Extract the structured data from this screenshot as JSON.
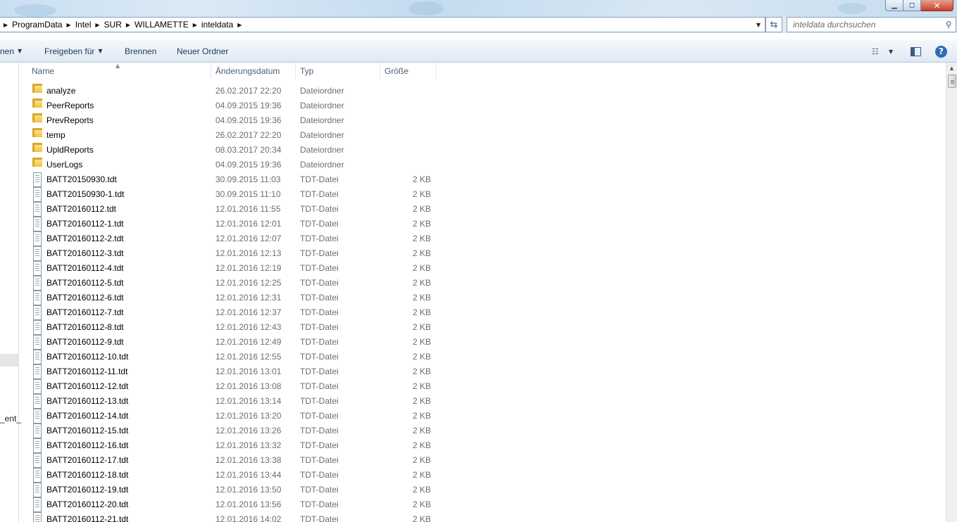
{
  "window": {
    "minimize_glyph": "▁",
    "maximize_glyph": "◻",
    "close_glyph": "✕"
  },
  "address": {
    "crumbs": [
      "ProgramData",
      "Intel",
      "SUR",
      "WILLAMETTE",
      "inteldata"
    ],
    "dropdown_icon": "chevron-down-icon",
    "refresh_icon": "refresh-icon"
  },
  "search": {
    "placeholder": "inteldata durchsuchen",
    "icon": "search-icon"
  },
  "toolbar": {
    "organize_label": "nen",
    "share_label": "Freigeben für",
    "burn_label": "Brennen",
    "new_folder_label": "Neuer Ordner",
    "help_glyph": "?"
  },
  "nav": {
    "partial_label": "_ent_"
  },
  "columns": {
    "name": "Name",
    "date": "Änderungsdatum",
    "type": "Typ",
    "size": "Größe"
  },
  "files": [
    {
      "name": "analyze",
      "date": "26.02.2017 22:20",
      "type": "Dateiordner",
      "size": "",
      "kind": "folder"
    },
    {
      "name": "PeerReports",
      "date": "04.09.2015 19:36",
      "type": "Dateiordner",
      "size": "",
      "kind": "folder"
    },
    {
      "name": "PrevReports",
      "date": "04.09.2015 19:36",
      "type": "Dateiordner",
      "size": "",
      "kind": "folder"
    },
    {
      "name": "temp",
      "date": "26.02.2017 22:20",
      "type": "Dateiordner",
      "size": "",
      "kind": "folder"
    },
    {
      "name": "UpldReports",
      "date": "08.03.2017 20:34",
      "type": "Dateiordner",
      "size": "",
      "kind": "folder"
    },
    {
      "name": "UserLogs",
      "date": "04.09.2015 19:36",
      "type": "Dateiordner",
      "size": "",
      "kind": "folder"
    },
    {
      "name": "BATT20150930.tdt",
      "date": "30.09.2015 11:03",
      "type": "TDT-Datei",
      "size": "2 KB",
      "kind": "file"
    },
    {
      "name": "BATT20150930-1.tdt",
      "date": "30.09.2015 11:10",
      "type": "TDT-Datei",
      "size": "2 KB",
      "kind": "file"
    },
    {
      "name": "BATT20160112.tdt",
      "date": "12.01.2016 11:55",
      "type": "TDT-Datei",
      "size": "2 KB",
      "kind": "file"
    },
    {
      "name": "BATT20160112-1.tdt",
      "date": "12.01.2016 12:01",
      "type": "TDT-Datei",
      "size": "2 KB",
      "kind": "file"
    },
    {
      "name": "BATT20160112-2.tdt",
      "date": "12.01.2016 12:07",
      "type": "TDT-Datei",
      "size": "2 KB",
      "kind": "file"
    },
    {
      "name": "BATT20160112-3.tdt",
      "date": "12.01.2016 12:13",
      "type": "TDT-Datei",
      "size": "2 KB",
      "kind": "file"
    },
    {
      "name": "BATT20160112-4.tdt",
      "date": "12.01.2016 12:19",
      "type": "TDT-Datei",
      "size": "2 KB",
      "kind": "file"
    },
    {
      "name": "BATT20160112-5.tdt",
      "date": "12.01.2016 12:25",
      "type": "TDT-Datei",
      "size": "2 KB",
      "kind": "file"
    },
    {
      "name": "BATT20160112-6.tdt",
      "date": "12.01.2016 12:31",
      "type": "TDT-Datei",
      "size": "2 KB",
      "kind": "file"
    },
    {
      "name": "BATT20160112-7.tdt",
      "date": "12.01.2016 12:37",
      "type": "TDT-Datei",
      "size": "2 KB",
      "kind": "file"
    },
    {
      "name": "BATT20160112-8.tdt",
      "date": "12.01.2016 12:43",
      "type": "TDT-Datei",
      "size": "2 KB",
      "kind": "file"
    },
    {
      "name": "BATT20160112-9.tdt",
      "date": "12.01.2016 12:49",
      "type": "TDT-Datei",
      "size": "2 KB",
      "kind": "file"
    },
    {
      "name": "BATT20160112-10.tdt",
      "date": "12.01.2016 12:55",
      "type": "TDT-Datei",
      "size": "2 KB",
      "kind": "file"
    },
    {
      "name": "BATT20160112-11.tdt",
      "date": "12.01.2016 13:01",
      "type": "TDT-Datei",
      "size": "2 KB",
      "kind": "file"
    },
    {
      "name": "BATT20160112-12.tdt",
      "date": "12.01.2016 13:08",
      "type": "TDT-Datei",
      "size": "2 KB",
      "kind": "file"
    },
    {
      "name": "BATT20160112-13.tdt",
      "date": "12.01.2016 13:14",
      "type": "TDT-Datei",
      "size": "2 KB",
      "kind": "file"
    },
    {
      "name": "BATT20160112-14.tdt",
      "date": "12.01.2016 13:20",
      "type": "TDT-Datei",
      "size": "2 KB",
      "kind": "file"
    },
    {
      "name": "BATT20160112-15.tdt",
      "date": "12.01.2016 13:26",
      "type": "TDT-Datei",
      "size": "2 KB",
      "kind": "file"
    },
    {
      "name": "BATT20160112-16.tdt",
      "date": "12.01.2016 13:32",
      "type": "TDT-Datei",
      "size": "2 KB",
      "kind": "file"
    },
    {
      "name": "BATT20160112-17.tdt",
      "date": "12.01.2016 13:38",
      "type": "TDT-Datei",
      "size": "2 KB",
      "kind": "file"
    },
    {
      "name": "BATT20160112-18.tdt",
      "date": "12.01.2016 13:44",
      "type": "TDT-Datei",
      "size": "2 KB",
      "kind": "file"
    },
    {
      "name": "BATT20160112-19.tdt",
      "date": "12.01.2016 13:50",
      "type": "TDT-Datei",
      "size": "2 KB",
      "kind": "file"
    },
    {
      "name": "BATT20160112-20.tdt",
      "date": "12.01.2016 13:56",
      "type": "TDT-Datei",
      "size": "2 KB",
      "kind": "file"
    },
    {
      "name": "BATT20160112-21.tdt",
      "date": "12.01.2016 14:02",
      "type": "TDT-Datei",
      "size": "2 KB",
      "kind": "file"
    }
  ]
}
